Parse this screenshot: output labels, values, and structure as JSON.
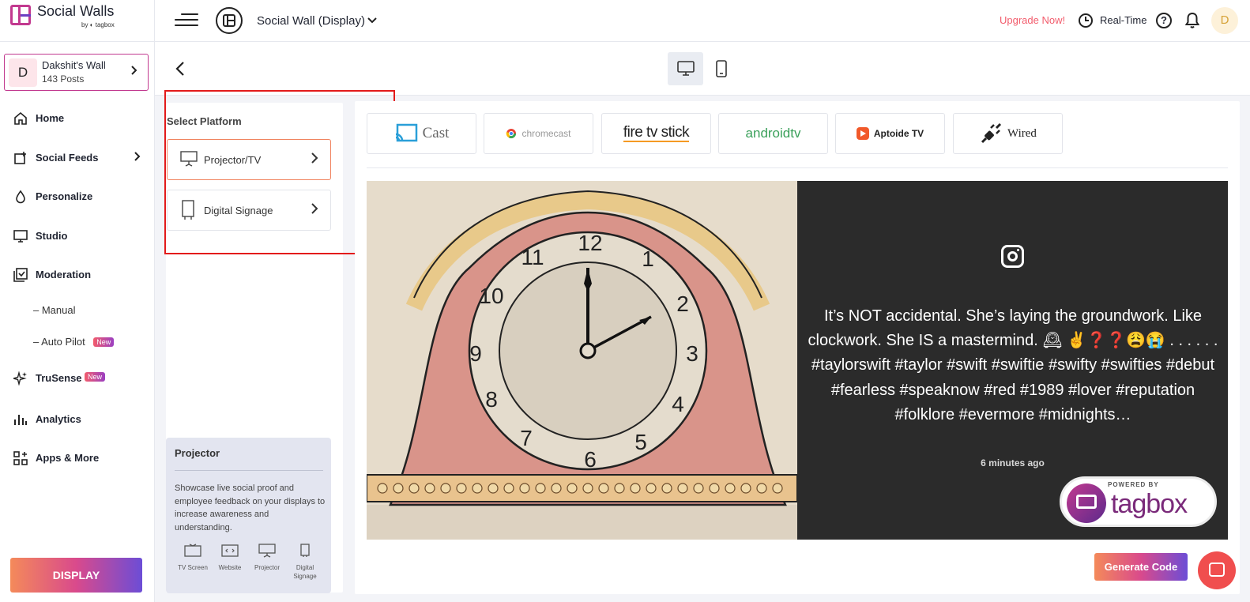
{
  "brand": {
    "title": "Social Walls",
    "subtitle": "by ◐ tagbox"
  },
  "header": {
    "wall_switch_label": "Social Wall (Display)",
    "upgrade_label": "Upgrade Now!",
    "realtime_label": "Real-Time",
    "help_glyph": "?",
    "user_initial": "D"
  },
  "wall_card": {
    "initial": "D",
    "name": "Dakshit's Wall",
    "posts": "143 Posts"
  },
  "sidebar": {
    "items": [
      {
        "label": "Home",
        "icon": "home-icon"
      },
      {
        "label": "Social Feeds",
        "icon": "social-feeds-icon"
      },
      {
        "label": "Personalize",
        "icon": "personalize-icon"
      },
      {
        "label": "Studio",
        "icon": "studio-icon"
      },
      {
        "label": "Moderation",
        "icon": "moderation-icon"
      },
      {
        "label": "TruSense",
        "icon": "sparkle-icon",
        "badge": "New"
      },
      {
        "label": "Analytics",
        "icon": "analytics-icon"
      },
      {
        "label": "Apps & More",
        "icon": "apps-icon"
      }
    ],
    "sub_items": [
      {
        "label": "Manual"
      },
      {
        "label": "Auto Pilot",
        "badge": "New"
      }
    ],
    "display_button": "DISPLAY"
  },
  "platform": {
    "heading": "Select Platform",
    "options": [
      {
        "label": "Projector/TV",
        "icon": "projector-icon",
        "active": true
      },
      {
        "label": "Digital Signage",
        "icon": "signage-icon",
        "active": false
      }
    ]
  },
  "info": {
    "title": "Projector",
    "text": "Showcase live social proof and employee feedback on your displays to increase awareness and understanding.",
    "icons": [
      {
        "label": "TV Screen",
        "icon": "tv-icon"
      },
      {
        "label": "Website",
        "icon": "website-icon"
      },
      {
        "label": "Projector",
        "icon": "projector-icon"
      },
      {
        "label": "Digital Signage",
        "icon": "signage-icon"
      }
    ]
  },
  "tiles": [
    {
      "label": "Cast",
      "icon": "cast-icon"
    },
    {
      "label": "chromecast",
      "icon": "chrome-icon"
    },
    {
      "label": "fire tv stick",
      "icon": "firetv-icon"
    },
    {
      "label": "androidtv",
      "icon": "androidtv-icon"
    },
    {
      "label": "Aptoide TV",
      "icon": "aptoide-icon"
    },
    {
      "label": "Wired",
      "icon": "plug-icon"
    }
  ],
  "post": {
    "platform_icon": "instagram-icon",
    "caption": "It’s NOT accidental. She’s laying the groundwork. Like clockwork. She IS a mastermind. 🕰 ✌❓❓😩😭 . . . . . . #taylorswift #taylor #swift #swiftie #swifty #swifties #debut #fearless #speaknow #red #1989 #lover #reputation #folklore #evermore #midnights…",
    "time": "6 minutes ago"
  },
  "powered": {
    "by": "POWERED BY",
    "brand": "tagbox"
  },
  "generate_button": "Generate Code",
  "colors": {
    "accent_start": "#f48a5a",
    "accent_end": "#6c4dd6",
    "upgrade": "#f25c6c",
    "highlight": "#e31b1b",
    "post_bg": "#2b2b2b"
  }
}
